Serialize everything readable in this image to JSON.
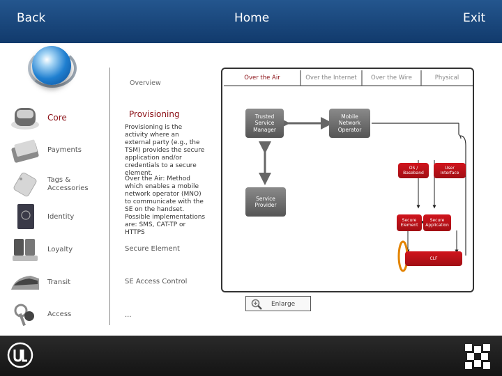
{
  "header": {
    "back": "Back",
    "home": "Home",
    "exit": "Exit"
  },
  "sidebar": {
    "items": [
      {
        "label": "Core",
        "icon": "phone-icon"
      },
      {
        "label": "Payments",
        "icon": "wallet-icon"
      },
      {
        "label": "Tags &\nAccessories",
        "icon": "tag-icon"
      },
      {
        "label": "Identity",
        "icon": "passport-icon"
      },
      {
        "label": "Loyalty",
        "icon": "loyalty-cards-icon"
      },
      {
        "label": "Transit",
        "icon": "train-icon"
      },
      {
        "label": "Access",
        "icon": "keys-icon"
      }
    ]
  },
  "panel": {
    "overview": "Overview",
    "heading": "Provisioning",
    "paragraph1": "Provisioning is the activity where an external party (e.g., the TSM) provides the secure application and/or credentials to a secure element.",
    "paragraph2": "Over the Air: Method which enables a mobile network operator (MNO) to communicate with the SE on the handset. Possible implementations are: SMS, CAT-TP or HTTPS",
    "links": [
      "Secure Element",
      "SE Access Control",
      "..."
    ]
  },
  "diagram": {
    "tabs": [
      "Over the Air",
      "Over the Internet",
      "Over the Wire",
      "Physical"
    ],
    "nodes": {
      "tsm": "Trusted\nService\nManager",
      "mno": "Mobile\nNetwork\nOperator",
      "sp": "Service\nProvider",
      "os": "OS /\nBaseband",
      "ui": "User\nInterface",
      "se": "Secure\nElement",
      "sa": "Secure\nApplication",
      "clf": "CLF"
    },
    "enlarge": "Enlarge"
  },
  "colors": {
    "accent": "#8b1016",
    "header": "#1b4a80",
    "node_red": "#c8141c",
    "node_grey": "#6a6a6a"
  }
}
